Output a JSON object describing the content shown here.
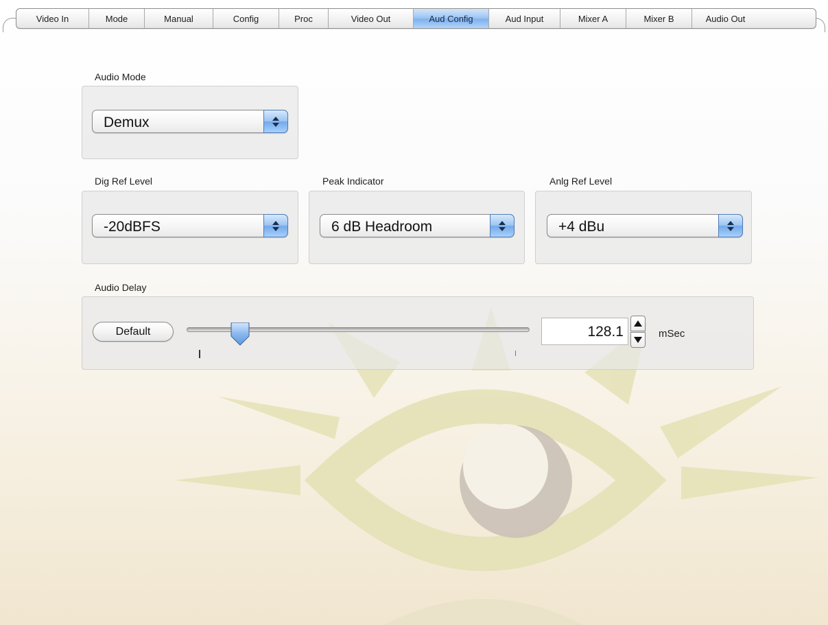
{
  "tabs": [
    {
      "label": "Video In",
      "active": false
    },
    {
      "label": "Mode",
      "active": false
    },
    {
      "label": "Manual",
      "active": false
    },
    {
      "label": "Config",
      "active": false
    },
    {
      "label": "Proc",
      "active": false
    },
    {
      "label": "Video Out",
      "active": false
    },
    {
      "label": "Aud Config",
      "active": true
    },
    {
      "label": "Aud Input",
      "active": false
    },
    {
      "label": "Mixer A",
      "active": false
    },
    {
      "label": "Mixer B",
      "active": false
    },
    {
      "label": "Audio Out",
      "active": false
    }
  ],
  "audio_mode": {
    "label": "Audio Mode",
    "value": "Demux"
  },
  "dig_ref_level": {
    "label": "Dig Ref Level",
    "value": "-20dBFS"
  },
  "peak_indicator": {
    "label": "Peak Indicator",
    "value": "6 dB Headroom"
  },
  "anlg_ref_level": {
    "label": "Anlg Ref Level",
    "value": "+4 dBu"
  },
  "audio_delay": {
    "label": "Audio Delay",
    "default_label": "Default",
    "value": "128.1",
    "unit": "mSec",
    "slider_fraction": 0.15
  },
  "colors": {
    "accent": "#7fb2ee",
    "watermark": "#e3e0b4",
    "watermark_iris": "#c9c0b6"
  },
  "icons": {
    "popup": "updown-chevron-icon",
    "stepper_up": "triangle-up-icon",
    "stepper_down": "triangle-down-icon",
    "watermark": "eye-logo"
  }
}
